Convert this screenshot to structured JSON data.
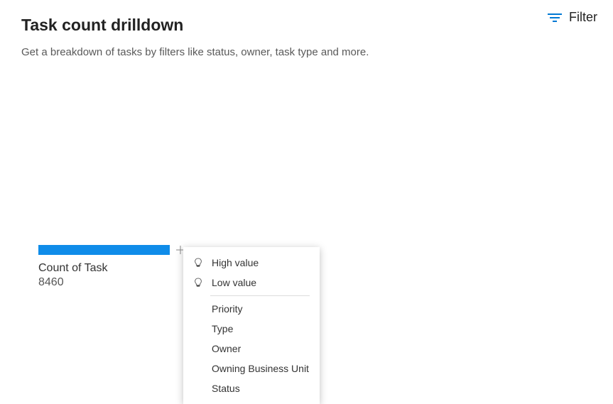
{
  "header": {
    "title": "Task count drilldown",
    "subtitle": "Get a breakdown of tasks by filters like status, owner, task type and more.",
    "filter_label": "Filter"
  },
  "chart_data": {
    "type": "bar",
    "categories": [
      "Count of Task"
    ],
    "values": [
      8460
    ],
    "title": "",
    "xlabel": "",
    "ylabel": ""
  },
  "bar": {
    "label": "Count of Task",
    "value": "8460"
  },
  "dropdown": {
    "items_with_icon": [
      "High value",
      "Low value"
    ],
    "items": [
      "Priority",
      "Type",
      "Owner",
      "Owning Business Unit",
      "Status"
    ]
  }
}
